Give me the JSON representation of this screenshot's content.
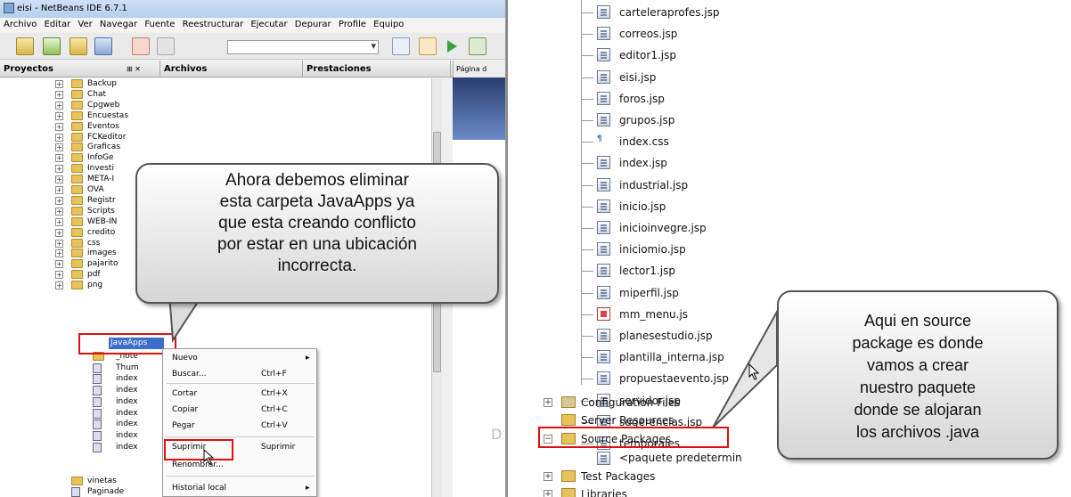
{
  "window_title": "eisi - NetBeans IDE 6.7.1",
  "menu": [
    "Archivo",
    "Editar",
    "Ver",
    "Navegar",
    "Fuente",
    "Reestructurar",
    "Ejecutar",
    "Depurar",
    "Profile",
    "Equipo"
  ],
  "pane_tabs": {
    "proyectos": "Proyectos",
    "archivos": "Archivos",
    "prestaciones": "Prestaciones",
    "pane_controls": "⊞ ✕"
  },
  "editor_tab": "Página d",
  "editor_watermark": "D",
  "tree_items": [
    "Backup",
    "Chat",
    "Cpgweb",
    "Encuestas",
    "Eventos",
    "FCKeditor",
    "Graficas",
    "InfoGe",
    "Investi",
    "META-I",
    "OVA",
    "Registr",
    "Scripts",
    "WEB-IN",
    "credito",
    "css",
    "images",
    "pajarito",
    "pdf",
    "png"
  ],
  "selected_item": "JavaApps",
  "tree_after": [
    "_note",
    "Thum",
    "index",
    "index",
    "index",
    "index",
    "index",
    "index",
    "index"
  ],
  "tree_bottom": [
    "vinetas",
    "Paginade"
  ],
  "context_menu": [
    {
      "label": "Nuevo",
      "shortcut": "",
      "arrow": "▸"
    },
    {
      "label": "Buscar...",
      "shortcut": "Ctrl+F",
      "arrow": ""
    },
    {
      "label": "Cortar",
      "shortcut": "Ctrl+X",
      "arrow": ""
    },
    {
      "label": "Copiar",
      "shortcut": "Ctrl+C",
      "arrow": ""
    },
    {
      "label": "Pegar",
      "shortcut": "Ctrl+V",
      "arrow": ""
    },
    {
      "label": "Suprimir",
      "shortcut": "Suprimir",
      "arrow": ""
    },
    {
      "label": "Renombrar...",
      "shortcut": "",
      "arrow": ""
    },
    {
      "label": "Historial local",
      "shortcut": "",
      "arrow": "▸"
    }
  ],
  "callout_left": [
    "Ahora debemos eliminar",
    "esta carpeta JavaApps ya",
    "que esta creando conflicto",
    "por estar en una ubicación",
    "incorrecta."
  ],
  "right_files": [
    {
      "name": "carteleraprofes.jsp",
      "icon": "jsp"
    },
    {
      "name": "correos.jsp",
      "icon": "jsp"
    },
    {
      "name": "editor1.jsp",
      "icon": "jsp"
    },
    {
      "name": "eisi.jsp",
      "icon": "jsp"
    },
    {
      "name": "foros.jsp",
      "icon": "jsp"
    },
    {
      "name": "grupos.jsp",
      "icon": "jsp"
    },
    {
      "name": "index.css",
      "icon": "css"
    },
    {
      "name": "index.jsp",
      "icon": "jsp"
    },
    {
      "name": "industrial.jsp",
      "icon": "jsp"
    },
    {
      "name": "inicio.jsp",
      "icon": "jsp"
    },
    {
      "name": "inicioinvegre.jsp",
      "icon": "jsp"
    },
    {
      "name": "iniciomio.jsp",
      "icon": "jsp"
    },
    {
      "name": "lector1.jsp",
      "icon": "jsp"
    },
    {
      "name": "miperfil.jsp",
      "icon": "jsp"
    },
    {
      "name": "mm_menu.js",
      "icon": "js"
    },
    {
      "name": "planesestudio.jsp",
      "icon": "jsp"
    },
    {
      "name": "plantilla_interna.jsp",
      "icon": "jsp"
    },
    {
      "name": "propuestaevento.jsp",
      "icon": "jsp"
    },
    {
      "name": "servidor.jsp",
      "icon": "jsp"
    },
    {
      "name": "sugerencias.jsp",
      "icon": "jsp"
    },
    {
      "name": "temporales",
      "icon": "folder"
    }
  ],
  "right_nodes": {
    "config": "Configuration Files",
    "server": "Server Resources",
    "source": "Source Packages",
    "default_pkg": "<paquete predetermin",
    "test": "Test Packages",
    "libs": "Libraries"
  },
  "callout_right": [
    "Aqui en source",
    "package es donde",
    "vamos a crear",
    "nuestro paquete",
    "donde se alojaran",
    "los archivos .java"
  ],
  "colors": {
    "selection": "#3c6dc8",
    "highlight": "#e01010",
    "folder": "#e8c25a"
  }
}
